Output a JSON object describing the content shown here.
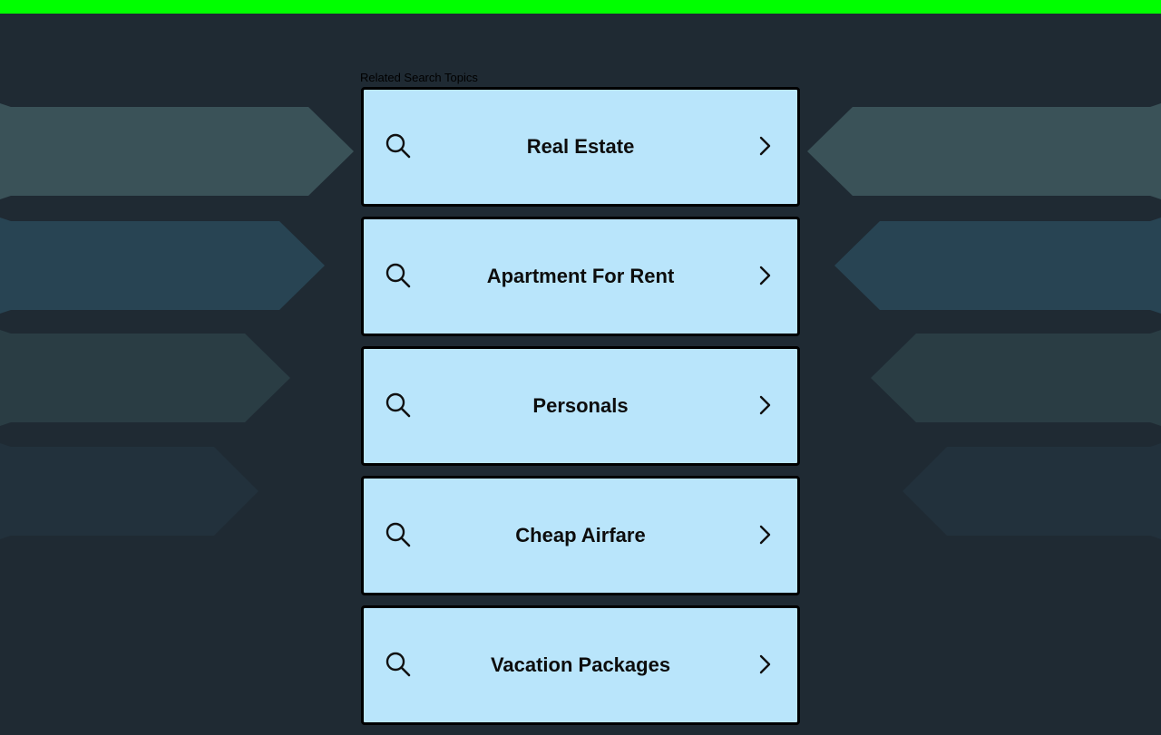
{
  "colors": {
    "top_bar": "#00ff00",
    "page_background": "#1f2a33",
    "card_background": "#b9e5fb",
    "card_border": "#000000",
    "arrow_row_1": "#3a5258",
    "arrow_row_2": "#284453",
    "arrow_row_3": "#2a3d44",
    "arrow_row_4": "#22313c"
  },
  "heading": "Related Search Topics",
  "topics": [
    {
      "label": "Real Estate",
      "icon": "search-icon",
      "arrow": "chevron-right-icon"
    },
    {
      "label": "Apartment For Rent",
      "icon": "search-icon",
      "arrow": "chevron-right-icon"
    },
    {
      "label": "Personals",
      "icon": "search-icon",
      "arrow": "chevron-right-icon"
    },
    {
      "label": "Cheap Airfare",
      "icon": "search-icon",
      "arrow": "chevron-right-icon"
    },
    {
      "label": "Vacation Packages",
      "icon": "search-icon",
      "arrow": "chevron-right-icon"
    }
  ]
}
